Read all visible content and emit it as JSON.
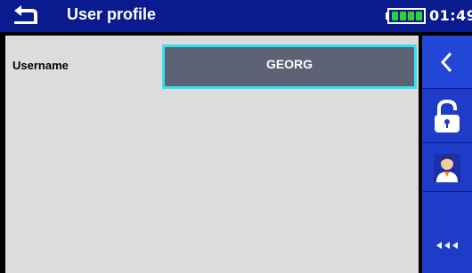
{
  "header": {
    "title": "User profile",
    "time": "01:49",
    "back_icon": "back-arrow-icon",
    "battery_icon": "battery-full-icon",
    "header_color": "#0a1a8f"
  },
  "profile": {
    "username_label": "Username",
    "username_value": "GEORG",
    "field_bg": "#5d6275",
    "focus_color": "#2de5f0"
  },
  "sidebar": {
    "color": "#1e3cc8",
    "buttons": [
      {
        "icon": "chevron-left-icon"
      },
      {
        "icon": "lock-icon"
      },
      {
        "icon": "user-icon"
      },
      {
        "icon": "more-options-icon",
        "label": "◂◂◂"
      }
    ]
  }
}
